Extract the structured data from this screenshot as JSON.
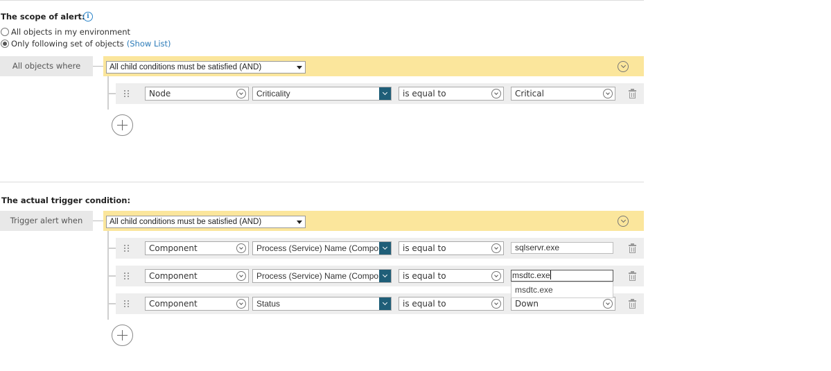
{
  "scope": {
    "title": "The scope of alert:",
    "info_icon": "info-icon",
    "radio_all": "All objects in my environment",
    "radio_only": "Only following set of objects",
    "show_list": "(Show List)",
    "selected": "only",
    "where_label": "All objects where",
    "group_select": "All child conditions must be satisfied (AND)",
    "conditions": [
      {
        "object": "Node",
        "property": "Criticality",
        "operator": "is equal to",
        "value": "Critical"
      }
    ]
  },
  "trigger": {
    "title": "The actual trigger condition:",
    "when_label": "Trigger alert when",
    "group_select": "All child conditions must be satisfied (AND)",
    "conditions": [
      {
        "object": "Component",
        "property": "Process (Service) Name (Compo",
        "operator": "is equal to",
        "value": "sqlservr.exe"
      },
      {
        "object": "Component",
        "property": "Process (Service) Name (Compo",
        "operator": "is equal to",
        "value": "msdtc.exe"
      },
      {
        "object": "Component",
        "property": "Status",
        "operator": "is equal to",
        "value": "Down"
      }
    ],
    "autocomplete_option": "msdtc.exe"
  },
  "icons": {
    "drag": "drag-handle-icon",
    "delete": "trash-icon",
    "add": "plus-circle-icon",
    "collapse": "chevron-down-circle-icon"
  },
  "colors": {
    "group_bar": "#fbe69c",
    "label_bg": "#e8e8e8",
    "row_bg": "#eeeeee",
    "dropdown_button": "#1f5e78",
    "link": "#2a7ab8"
  }
}
